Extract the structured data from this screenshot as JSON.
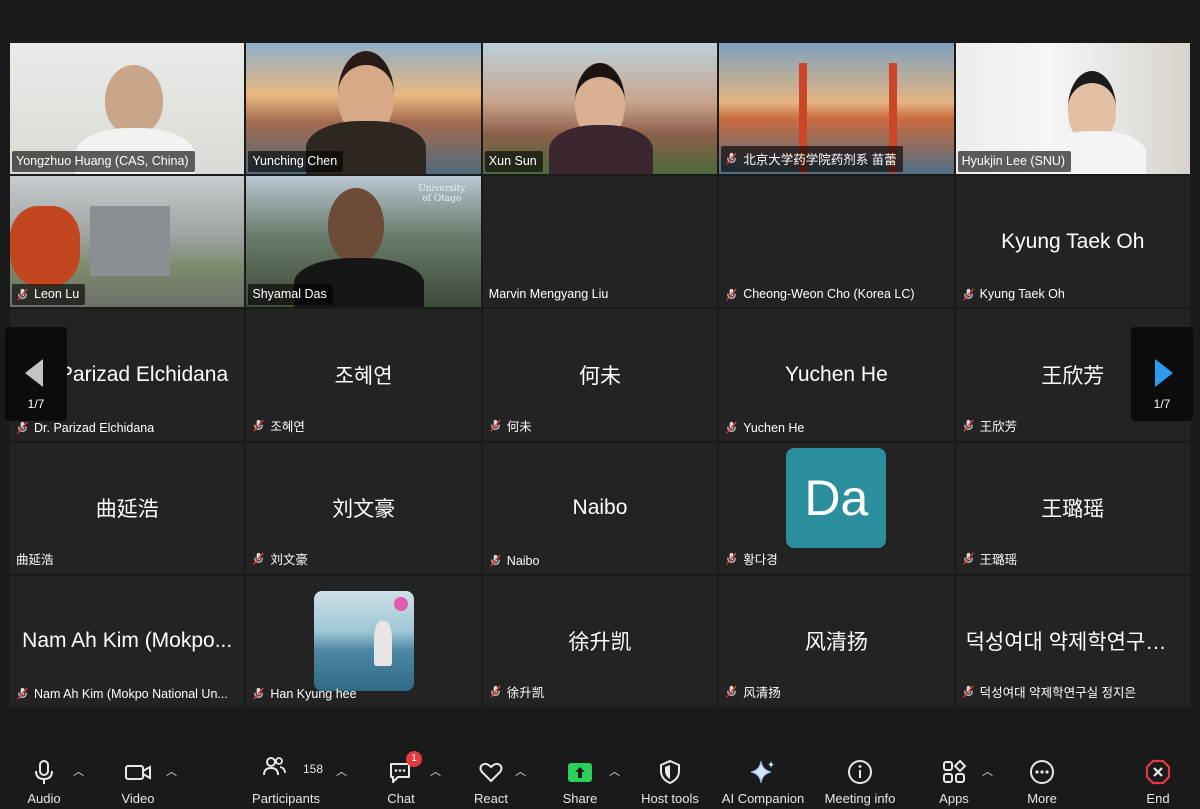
{
  "colors": {
    "active_border": "#2bd05a",
    "avatar_da": "#2a8e9c",
    "share_green": "#2bd05a",
    "chat_badge": "#e23b3b",
    "end_red": "#e23b3b",
    "nav_arrow": "#2e9bf0"
  },
  "tiles": [
    {
      "name": "Yongzhuo Huang (CAS, China)"
    },
    {
      "name": "Yunching Chen"
    },
    {
      "name": "Xun Sun"
    },
    {
      "name": "北京大学药学院药剂系 苗蕾"
    },
    {
      "name": "Hyukjin Lee (SNU)"
    },
    {
      "name": "Leon Lu"
    },
    {
      "name": "Shyamal Das",
      "watermark": "University of Otago"
    },
    {
      "name": "Marvin Mengyang Liu"
    },
    {
      "name": "Cheong-Weon Cho (Korea LC)"
    },
    {
      "name": "Kyung Taek Oh",
      "big": "Kyung Taek Oh"
    },
    {
      "name": "Dr. Parizad Elchidana",
      "big": "Dr. Parizad Elchidana"
    },
    {
      "name": "조혜연",
      "big": "조혜연"
    },
    {
      "name": "何未",
      "big": "何未"
    },
    {
      "name": "Yuchen He",
      "big": "Yuchen He"
    },
    {
      "name": "王欣芳",
      "big": "王欣芳"
    },
    {
      "name": "曲延浩",
      "big": "曲延浩"
    },
    {
      "name": "刘文豪",
      "big": "刘文豪"
    },
    {
      "name": "Naibo",
      "big": "Naibo"
    },
    {
      "name": "황다경",
      "avatar": "Da"
    },
    {
      "name": "王璐瑶",
      "big": "王璐瑶"
    },
    {
      "name": "Nam Ah Kim (Mokpo National Un...",
      "big": "Nam Ah Kim (Mokpo..."
    },
    {
      "name": "Han Kyung hee"
    },
    {
      "name": "徐升凯",
      "big": "徐升凯"
    },
    {
      "name": "风清扬",
      "big": "风清扬"
    },
    {
      "name": "덕성여대 약제학연구실 정지은",
      "big": "덕성여대 약제학연구실..."
    }
  ],
  "nav": {
    "prev_page": "1/7",
    "next_page": "1/7"
  },
  "toolbar": {
    "audio": "Audio",
    "video": "Video",
    "participants": "Participants",
    "participants_count": "158",
    "chat": "Chat",
    "chat_badge": "1",
    "react": "React",
    "share": "Share",
    "host_tools": "Host tools",
    "ai_companion": "AI Companion",
    "meeting_info": "Meeting info",
    "apps": "Apps",
    "more": "More",
    "end": "End"
  }
}
